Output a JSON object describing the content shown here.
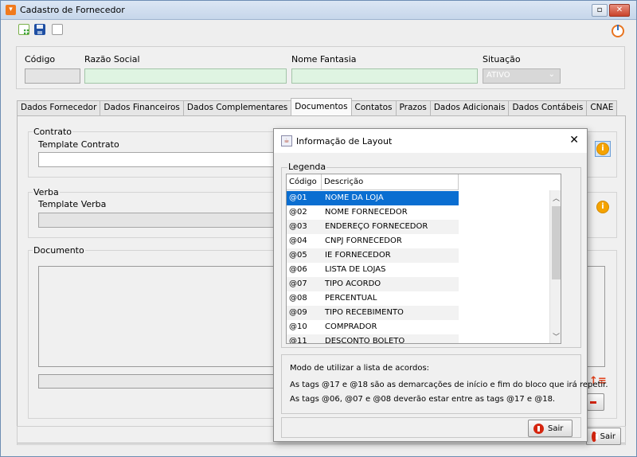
{
  "window": {
    "title": "Cadastro de Fornecedor",
    "restore_label": "▫",
    "close_label": "✕"
  },
  "toolbar": {
    "icons": [
      "new-icon",
      "save-icon",
      "copy-icon"
    ],
    "power_icon": "power-icon"
  },
  "header": {
    "codigo_label": "Código",
    "razao_label": "Razão Social",
    "fantasia_label": "Nome Fantasia",
    "situacao_label": "Situação",
    "situacao_value": "ATIVO"
  },
  "tabs": [
    {
      "label": "Dados Fornecedor"
    },
    {
      "label": "Dados Financeiros"
    },
    {
      "label": "Dados Complementares"
    },
    {
      "label": "Documentos"
    },
    {
      "label": "Contatos"
    },
    {
      "label": "Prazos"
    },
    {
      "label": "Dados Adicionais"
    },
    {
      "label": "Dados Contábeis"
    },
    {
      "label": "CNAE"
    }
  ],
  "documentos": {
    "contrato_group": "Contrato",
    "template_contrato_label": "Template Contrato",
    "verba_group": "Verba",
    "template_verba_label": "Template Verba",
    "documento_group": "Documento",
    "sair_label": "Sair"
  },
  "dialog": {
    "title": "Informação de Layout",
    "close": "✕",
    "legend": "Legenda",
    "columns": [
      "Código",
      "Descrição"
    ],
    "rows": [
      {
        "code": "@01",
        "desc": "NOME DA LOJA"
      },
      {
        "code": "@02",
        "desc": "NOME FORNECEDOR"
      },
      {
        "code": "@03",
        "desc": "ENDEREÇO FORNECEDOR"
      },
      {
        "code": "@04",
        "desc": "CNPJ FORNECEDOR"
      },
      {
        "code": "@05",
        "desc": "IE FORNECEDOR"
      },
      {
        "code": "@06",
        "desc": "LISTA DE LOJAS"
      },
      {
        "code": "@07",
        "desc": "TIPO ACORDO"
      },
      {
        "code": "@08",
        "desc": "PERCENTUAL"
      },
      {
        "code": "@09",
        "desc": "TIPO RECEBIMENTO"
      },
      {
        "code": "@10",
        "desc": "COMPRADOR"
      },
      {
        "code": "@11",
        "desc": "DESCONTO BOLETO"
      }
    ],
    "selected_row": 0,
    "info": [
      "Modo de utilizar a lista de acordos:",
      "As tags @17 e @18 são as demarcações de início e fim do bloco que irá repetir.",
      "As tags @06, @07 e @08 deverão estar entre as tags @17 e @18."
    ],
    "sair_label": "Sair"
  },
  "colors": {
    "accent": "#0a6ed1",
    "warning": "#f5a300",
    "stop": "#d5250f",
    "field_green": "#dff4e2"
  }
}
